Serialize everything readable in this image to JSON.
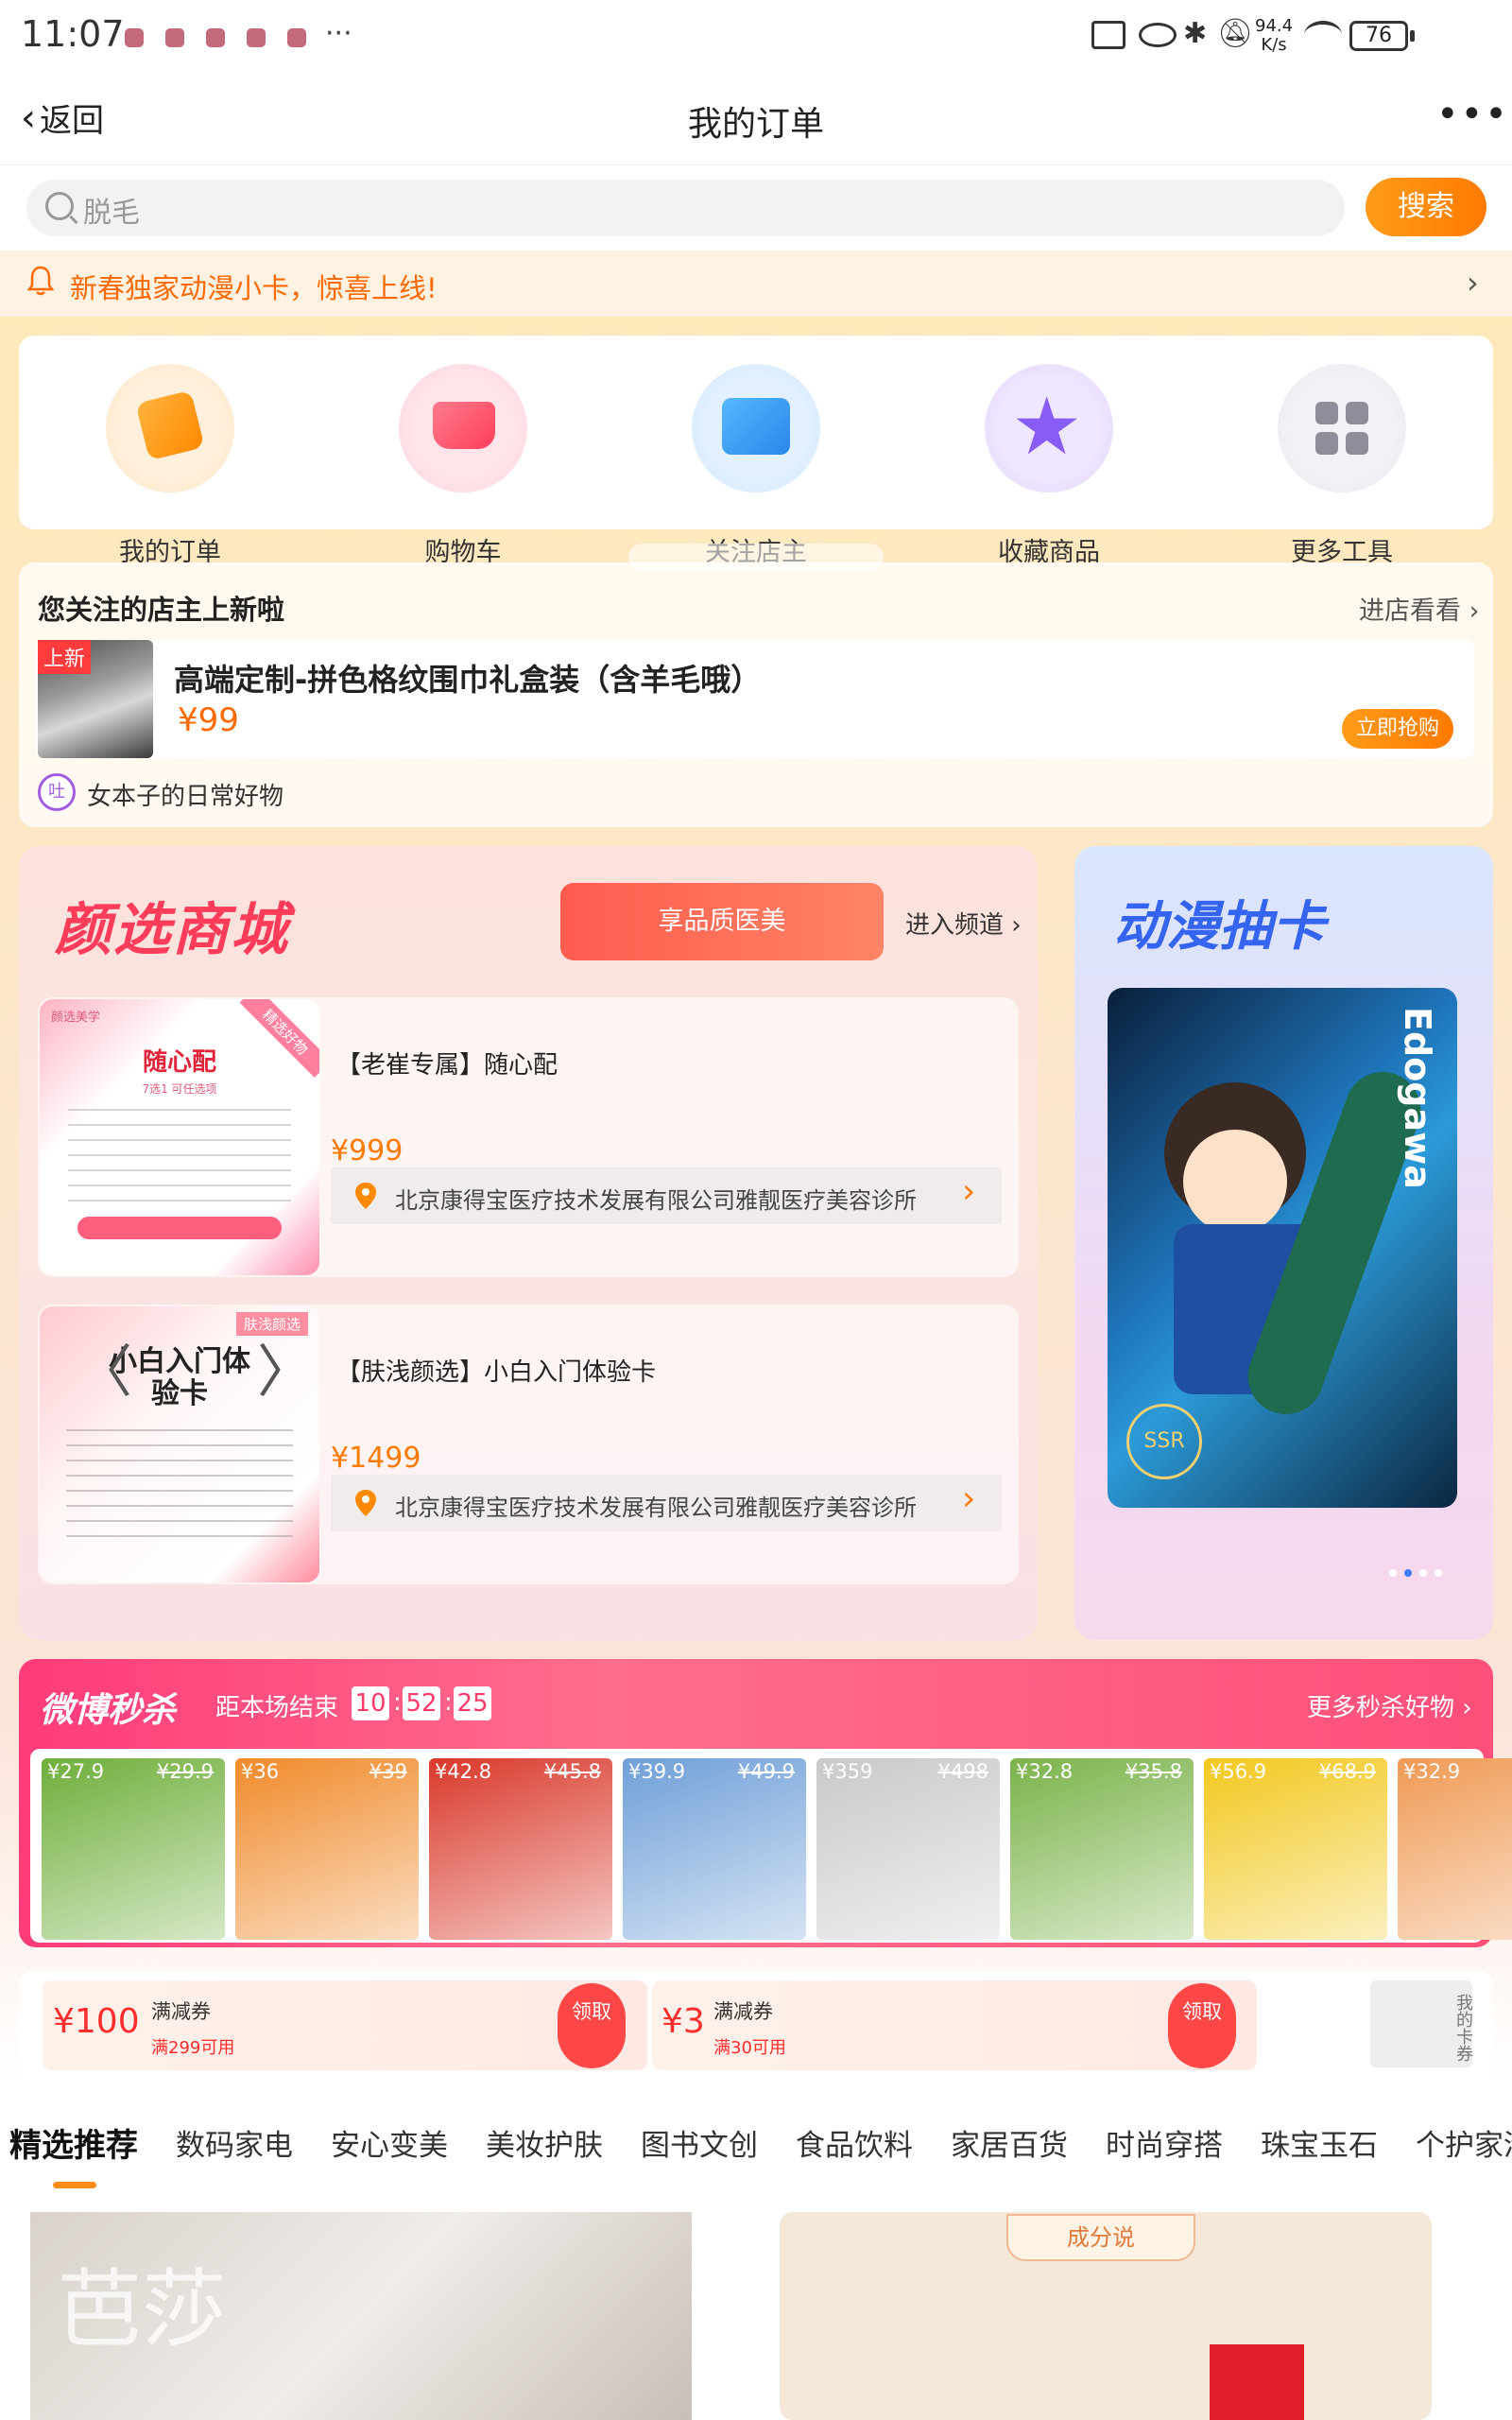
{
  "status_bar": {
    "time": "11:07",
    "dots": "···",
    "net_speed_value": "94.4",
    "net_speed_unit": "K/s",
    "battery": "76"
  },
  "nav": {
    "back_label": "返回",
    "title": "我的订单"
  },
  "search": {
    "placeholder": "脱毛",
    "button": "搜索"
  },
  "notice": {
    "text": "新春独家动漫小卡，惊喜上线!"
  },
  "tools": [
    {
      "label": "我的订单",
      "icon": "shopping-bag-icon",
      "color": "#ff9c1a"
    },
    {
      "label": "购物车",
      "icon": "cart-icon",
      "color": "#ff4f6a"
    },
    {
      "label": "关注店主",
      "icon": "store-icon",
      "color": "#3a9cf0"
    },
    {
      "label": "收藏商品",
      "icon": "star-icon",
      "color": "#8a5cf6"
    },
    {
      "label": "更多工具",
      "icon": "grid-icon",
      "color": "#9b9ba8"
    }
  ],
  "store_update": {
    "title": "您关注的店主上新啦",
    "visit": "进店看看",
    "new_badge": "上新",
    "product_title": "高端定制-拼色格纹围巾礼盒装（含羊毛哦）",
    "price": "¥99",
    "buy_button": "立即抢购",
    "shop_avatar_text": "吐",
    "shop_name": "女本子的日常好物"
  },
  "mall": {
    "logo": "颜选商城",
    "tab": "享品质医美",
    "enter": "进入频道",
    "deals": [
      {
        "thumb_title": "随心配",
        "thumb_tag": "精选好物",
        "thumb_brand": "颜选美学",
        "thumb_note": "7选1 可任选项",
        "title": "【老崔专属】随心配",
        "price": "¥999",
        "clinic": "北京康得宝医疗技术发展有限公司雅靓医疗美容诊所"
      },
      {
        "thumb_title": "小白入门体验卡",
        "thumb_tag": "肤浅颜选",
        "title": "【肤浅颜选】小白入门体验卡",
        "price": "¥1499",
        "clinic": "北京康得宝医疗技术发展有限公司雅靓医疗美容诊所"
      }
    ]
  },
  "anime": {
    "logo": "动漫抽卡",
    "card_name": "Edogawa",
    "card_rank": "SSR"
  },
  "flash_sale": {
    "logo": "微博秒杀",
    "ends_label": "距本场结束",
    "hours": "10",
    "minutes": "52",
    "seconds": "25",
    "more": "更多秒杀好物",
    "items": [
      {
        "price": "¥27.9",
        "orig": "¥29.9",
        "color": "#6fae3a"
      },
      {
        "price": "¥36",
        "orig": "¥39",
        "color": "#f08a2a"
      },
      {
        "price": "¥42.8",
        "orig": "¥45.8",
        "color": "#d9382a"
      },
      {
        "price": "¥39.9",
        "orig": "¥49.9",
        "color": "#6f9fd8"
      },
      {
        "price": "¥359",
        "orig": "¥498",
        "color": "#c9c9c9"
      },
      {
        "price": "¥32.8",
        "orig": "¥35.8",
        "color": "#7bb34a"
      },
      {
        "price": "¥56.9",
        "orig": "¥68.9",
        "color": "#f2c81e"
      },
      {
        "price": "¥32.9",
        "orig": "",
        "color": "#f09a55"
      }
    ]
  },
  "coupons": [
    {
      "amount": "¥100",
      "type": "满减券",
      "cond": "满299可用",
      "claim": "领取"
    },
    {
      "amount": "¥3",
      "type": "满减券",
      "cond": "满30可用",
      "claim": "领取"
    }
  ],
  "my_coupons": "我的卡券",
  "categories": [
    "精选推荐",
    "数码家电",
    "安心变美",
    "美妆护肤",
    "图书文创",
    "食品饮料",
    "家居百货",
    "时尚穿搭",
    "珠宝玉石",
    "个护家清"
  ],
  "feed": [
    {
      "overlay": "芭莎"
    },
    {
      "overlay": "成分说"
    }
  ]
}
